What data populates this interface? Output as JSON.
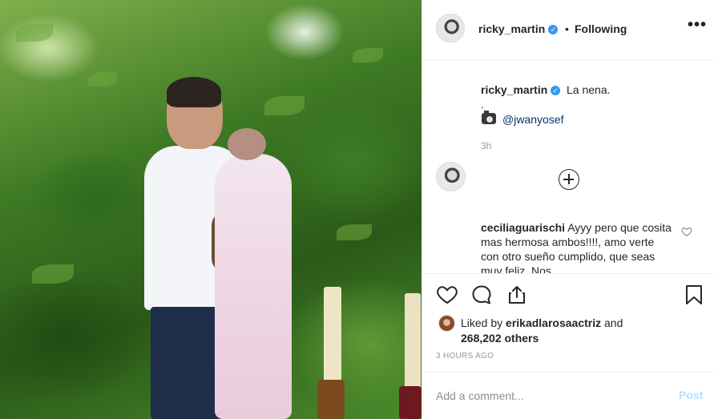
{
  "post": {
    "author": "ricky_martin",
    "follow_status": "Following",
    "separator": "•",
    "more_options": "•••"
  },
  "caption": {
    "username": "ricky_martin",
    "text": "La nena.",
    "dot": ".",
    "mention": "@jwanyosef",
    "time": "3h"
  },
  "comments": [
    {
      "username": "ceciliaguarischi",
      "text": "Ayyy pero que cosita mas hermosa ambos!!!!, amo verte con otro sueño cumplido, que seas muy feliz. Nos"
    }
  ],
  "likes": {
    "prefix": "Liked by",
    "user": "erikadlarosaactriz",
    "conjunction": "and",
    "count": "268,202 others"
  },
  "timestamp": "3 HOURS AGO",
  "add_comment": {
    "placeholder": "Add a comment...",
    "post_label": "Post"
  },
  "colors": {
    "verified_blue": "#3897f0",
    "post_button_disabled": "#b2dffc",
    "mention_link": "#003569"
  },
  "icons": {
    "like": "heart-icon",
    "comment": "comment-bubble-icon",
    "share": "share-icon",
    "save": "bookmark-icon",
    "load_more": "plus-circle-icon",
    "camera": "camera-emoji-icon"
  }
}
